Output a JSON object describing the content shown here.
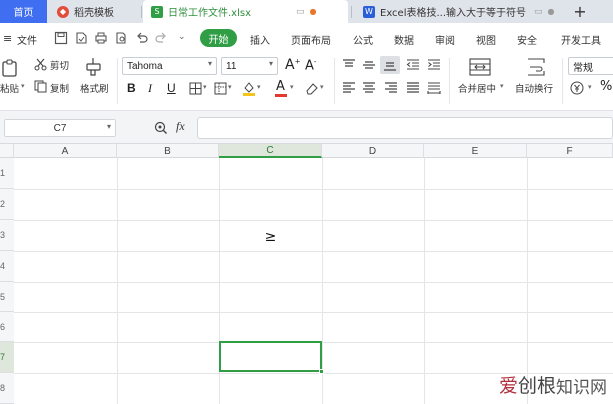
{
  "tabs": {
    "home": "首页",
    "template": "稻壳模板",
    "doc": "日常工作文件.xlsx",
    "web": "Excel表格技...输入大于等于符号",
    "add": "+"
  },
  "menu": {
    "file": "文件",
    "start": "开始",
    "insert": "插入",
    "page_layout": "页面布局",
    "formula": "公式",
    "data": "数据",
    "review": "审阅",
    "view": "视图",
    "security": "安全",
    "dev": "开发工具"
  },
  "ribbon": {
    "paste": "粘贴",
    "cut": "剪切",
    "copy": "复制",
    "format_painter": "格式刷",
    "font_name": "Tahoma",
    "font_size": "11",
    "bold": "B",
    "italic": "I",
    "underline": "U",
    "merge_center": "合并居中",
    "wrap_text": "自动换行",
    "number_format": "常规",
    "percent": "%"
  },
  "formula_bar": {
    "name_box": "C7",
    "fx": "fx",
    "content": ""
  },
  "grid": {
    "columns": [
      "A",
      "B",
      "C",
      "D",
      "E",
      "F"
    ],
    "selected_column": "C",
    "rows": [
      "1",
      "2",
      "3",
      "4",
      "5",
      "6",
      "7",
      "8"
    ],
    "selected_row": "7",
    "cells": {
      "C3": "≥"
    },
    "active_cell": "C7"
  },
  "watermark": {
    "part1": "爱",
    "part2": "创根",
    "part3": "知识网"
  },
  "colors": {
    "accent": "#2f9e44",
    "tab_blue": "#3f6ef0",
    "tabbar": "#dfe3ea"
  }
}
